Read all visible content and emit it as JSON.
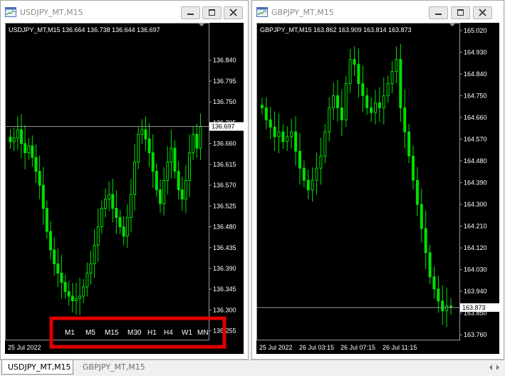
{
  "windows": [
    {
      "title": "USDJPY_MT,M15",
      "info": "USDJPY_MT,M15  136.664 136.738 136.644 136.697",
      "current_price": "136.697",
      "current_price_value": 136.697,
      "y_range": [
        136.236,
        136.915
      ],
      "price_ticks": [
        "136.840",
        "136.795",
        "136.750",
        "136.705",
        "136.660",
        "136.615",
        "136.570",
        "136.525",
        "136.480",
        "136.435",
        "136.390",
        "136.345",
        "136.300",
        "136.255"
      ],
      "time_labels": [
        "25 Jul 2022"
      ],
      "timeframes": [
        "M1",
        "M5",
        "M15",
        "M30",
        "H1",
        "H4",
        "W1",
        "MN"
      ],
      "series": [
        136.664,
        136.672,
        136.69,
        136.66,
        136.64,
        136.655,
        136.63,
        136.6,
        136.57,
        136.52,
        136.47,
        136.43,
        136.4,
        136.38,
        136.36,
        136.34,
        136.33,
        136.32,
        136.325,
        136.33,
        136.35,
        136.38,
        136.4,
        136.44,
        136.48,
        136.52,
        136.54,
        136.55,
        136.52,
        136.5,
        136.48,
        136.46,
        136.5,
        136.55,
        136.62,
        136.68,
        136.69,
        136.67,
        136.64,
        136.6,
        136.56,
        136.53,
        136.58,
        136.62,
        136.65,
        136.6,
        136.56,
        136.54,
        136.58,
        136.64,
        136.68,
        136.65,
        136.697
      ]
    },
    {
      "title": "GBPJPY_MT,M15",
      "info": "GBPJPY_MT,M15  163.862 163.909 163.814 163.873",
      "current_price": "163.873",
      "current_price_value": 163.873,
      "y_range": [
        163.74,
        165.04
      ],
      "price_ticks": [
        "165.020",
        "164.930",
        "164.840",
        "164.750",
        "164.660",
        "164.570",
        "164.480",
        "164.390",
        "164.300",
        "164.210",
        "164.120",
        "164.030",
        "163.940",
        "163.850",
        "163.760"
      ],
      "time_labels": [
        "25 Jul 2022",
        "26 Jul 03:15",
        "26 Jul 07:15",
        "26 Jul 11:15"
      ],
      "series": [
        164.7,
        164.65,
        164.62,
        164.58,
        164.6,
        164.56,
        164.58,
        164.6,
        164.52,
        164.45,
        164.4,
        164.36,
        164.4,
        164.45,
        164.5,
        164.6,
        164.7,
        164.75,
        164.7,
        164.65,
        164.8,
        164.9,
        164.88,
        164.8,
        164.75,
        164.7,
        164.68,
        164.72,
        164.7,
        164.75,
        164.8,
        164.85,
        164.9,
        164.7,
        164.6,
        164.5,
        164.4,
        164.3,
        164.2,
        164.1,
        164.0,
        163.95,
        163.9,
        163.86,
        163.88,
        163.873
      ]
    }
  ],
  "tabs": [
    "USDJPY_MT,M15",
    "GBPJPY_MT,M15"
  ],
  "colors": {
    "candle": "#00e000",
    "price_line": "#9a9a9a",
    "highlight": "#e00000",
    "chart_bg": "#000000"
  }
}
